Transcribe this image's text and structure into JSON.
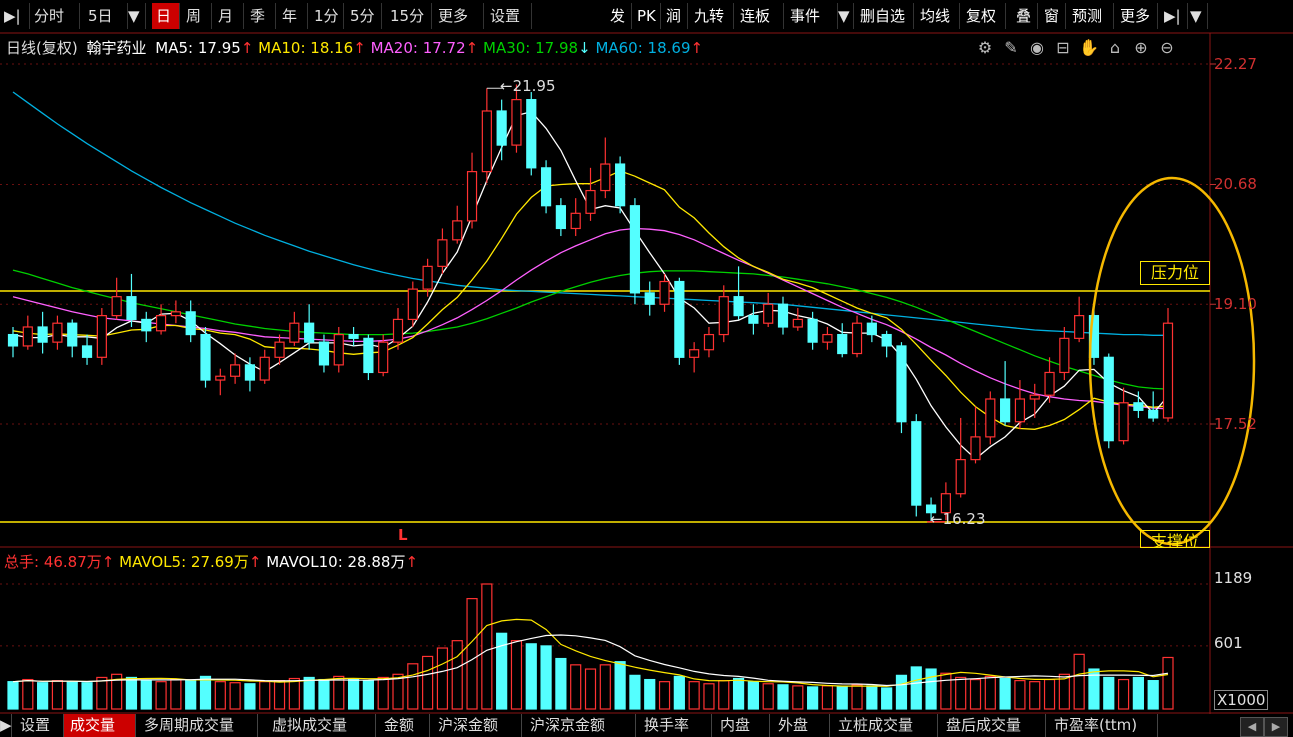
{
  "toolbar": {
    "left": [
      "分时",
      "5日",
      "日",
      "周",
      "月",
      "季",
      "年",
      "1分",
      "5分",
      "15分",
      "更多",
      "设置"
    ],
    "right": [
      "发",
      "PK",
      "涧",
      "九转",
      "连板",
      "事件",
      "删自选",
      "均线",
      "复权",
      "叠",
      "窗",
      "预测",
      "更多"
    ],
    "active": "日"
  },
  "info": {
    "period": "日线(复权)",
    "stock": "翰宇药业",
    "ma5": "MA5: 17.95",
    "ma10": "MA10: 18.16",
    "ma20": "MA20: 17.72",
    "ma30": "MA30: 17.98",
    "ma60": "MA60: 18.69",
    "arrow_up": "↑",
    "arrow_down": "↓"
  },
  "price_axis": [
    "22.27",
    "20.68",
    "19.10",
    "17.52"
  ],
  "annotations": {
    "high": "21.95",
    "low": "16.23",
    "marker": "L",
    "pressure": "压力位",
    "support": "支撑位"
  },
  "volume": {
    "total": "总手: 46.87万",
    "mavol5": "MAVOL5: 27.69万",
    "mavol10": "MAVOL10: 28.88万",
    "axis": [
      "1189",
      "601"
    ],
    "unit": "X1000"
  },
  "bottom_tabs": [
    "设置",
    "成交量",
    "多周期成交量",
    "虚拟成交量",
    "金额",
    "沪深金额",
    "沪深京金额",
    "换手率",
    "内盘",
    "外盘",
    "立桩成交量",
    "盘后成交量",
    "市盈率(ttm)"
  ],
  "bottom_active": "成交量",
  "colors": {
    "up": "#ff3232",
    "down": "#54ffff",
    "ma5": "#ffffff",
    "ma10": "#ffe800",
    "ma20": "#ff60ff",
    "ma30": "#00d000",
    "ma60": "#00b0e0",
    "accent": "#cc0000"
  },
  "icons": [
    "gear-icon",
    "pen-icon",
    "eye-icon",
    "box-icon",
    "hand-icon",
    "lock-icon",
    "zoom-in-icon",
    "zoom-out-icon"
  ],
  "candles": [
    [
      18.7,
      18.55,
      18.8,
      18.4
    ],
    [
      18.55,
      18.8,
      18.95,
      18.5
    ],
    [
      18.8,
      18.6,
      19.0,
      18.45
    ],
    [
      18.6,
      18.85,
      18.95,
      18.5
    ],
    [
      18.85,
      18.55,
      18.9,
      18.4
    ],
    [
      18.55,
      18.4,
      18.7,
      18.3
    ],
    [
      18.4,
      18.95,
      19.05,
      18.3
    ],
    [
      18.95,
      19.2,
      19.45,
      18.9
    ],
    [
      19.2,
      18.9,
      19.5,
      18.8
    ],
    [
      18.9,
      18.75,
      19.0,
      18.6
    ],
    [
      18.75,
      18.95,
      19.1,
      18.7
    ],
    [
      18.95,
      19.0,
      19.15,
      18.85
    ],
    [
      19.0,
      18.7,
      19.15,
      18.6
    ],
    [
      18.7,
      18.1,
      18.8,
      18.0
    ],
    [
      18.1,
      18.15,
      18.25,
      17.9
    ],
    [
      18.15,
      18.3,
      18.45,
      18.05
    ],
    [
      18.3,
      18.1,
      18.4,
      17.95
    ],
    [
      18.1,
      18.4,
      18.5,
      18.05
    ],
    [
      18.4,
      18.6,
      18.7,
      18.3
    ],
    [
      18.6,
      18.85,
      19.0,
      18.55
    ],
    [
      18.85,
      18.6,
      19.1,
      18.5
    ],
    [
      18.6,
      18.3,
      18.7,
      18.2
    ],
    [
      18.3,
      18.7,
      18.8,
      18.2
    ],
    [
      18.7,
      18.65,
      18.8,
      18.55
    ],
    [
      18.65,
      18.2,
      18.7,
      18.1
    ],
    [
      18.2,
      18.6,
      18.7,
      18.15
    ],
    [
      18.6,
      18.9,
      19.05,
      18.5
    ],
    [
      18.9,
      19.3,
      19.4,
      18.8
    ],
    [
      19.3,
      19.6,
      19.7,
      19.2
    ],
    [
      19.6,
      19.95,
      20.1,
      19.5
    ],
    [
      19.95,
      20.2,
      20.4,
      19.9
    ],
    [
      20.2,
      20.85,
      21.1,
      20.1
    ],
    [
      20.85,
      21.65,
      21.95,
      20.7
    ],
    [
      21.65,
      21.2,
      21.8,
      21.0
    ],
    [
      21.2,
      21.8,
      22.0,
      21.1
    ],
    [
      21.8,
      20.9,
      21.9,
      20.8
    ],
    [
      20.9,
      20.4,
      21.0,
      20.3
    ],
    [
      20.4,
      20.1,
      20.5,
      20.0
    ],
    [
      20.1,
      20.3,
      20.5,
      20.0
    ],
    [
      20.3,
      20.6,
      20.9,
      20.2
    ],
    [
      20.6,
      20.95,
      21.3,
      20.5
    ],
    [
      20.95,
      20.4,
      21.05,
      20.3
    ],
    [
      20.4,
      19.25,
      20.5,
      19.1
    ],
    [
      19.25,
      19.1,
      19.4,
      18.95
    ],
    [
      19.1,
      19.4,
      19.5,
      19.0
    ],
    [
      19.4,
      18.4,
      19.45,
      18.3
    ],
    [
      18.4,
      18.5,
      18.6,
      18.2
    ],
    [
      18.5,
      18.7,
      18.8,
      18.4
    ],
    [
      18.7,
      19.2,
      19.35,
      18.6
    ],
    [
      19.2,
      18.95,
      19.6,
      18.9
    ],
    [
      18.95,
      18.85,
      19.1,
      18.7
    ],
    [
      18.85,
      19.1,
      19.25,
      18.8
    ],
    [
      19.1,
      18.8,
      19.2,
      18.7
    ],
    [
      18.8,
      18.9,
      19.05,
      18.75
    ],
    [
      18.9,
      18.6,
      19.0,
      18.5
    ],
    [
      18.6,
      18.7,
      18.8,
      18.5
    ],
    [
      18.7,
      18.45,
      18.85,
      18.4
    ],
    [
      18.45,
      18.85,
      18.95,
      18.4
    ],
    [
      18.85,
      18.7,
      18.95,
      18.6
    ],
    [
      18.7,
      18.55,
      18.75,
      18.4
    ],
    [
      18.55,
      17.55,
      18.6,
      17.4
    ],
    [
      17.55,
      16.45,
      17.65,
      16.3
    ],
    [
      16.45,
      16.35,
      16.55,
      16.23
    ],
    [
      16.35,
      16.6,
      16.75,
      16.25
    ],
    [
      16.6,
      17.05,
      17.6,
      16.55
    ],
    [
      17.05,
      17.35,
      17.75,
      17.0
    ],
    [
      17.35,
      17.85,
      17.95,
      17.25
    ],
    [
      17.85,
      17.55,
      18.35,
      17.5
    ],
    [
      17.55,
      17.85,
      18.1,
      17.45
    ],
    [
      17.85,
      17.9,
      18.05,
      17.6
    ],
    [
      17.9,
      18.2,
      18.4,
      17.8
    ],
    [
      18.2,
      18.65,
      18.8,
      18.1
    ],
    [
      18.65,
      18.95,
      19.2,
      18.6
    ],
    [
      18.95,
      18.4,
      19.05,
      18.3
    ],
    [
      18.4,
      17.3,
      18.45,
      17.2
    ],
    [
      17.3,
      17.8,
      18.0,
      17.25
    ],
    [
      17.8,
      17.7,
      17.95,
      17.6
    ],
    [
      17.7,
      17.6,
      17.95,
      17.55
    ],
    [
      17.6,
      18.85,
      19.05,
      17.55
    ]
  ],
  "volumes": [
    260,
    280,
    250,
    270,
    260,
    250,
    300,
    330,
    300,
    270,
    260,
    280,
    270,
    310,
    260,
    250,
    240,
    260,
    270,
    290,
    300,
    280,
    310,
    280,
    270,
    300,
    330,
    430,
    500,
    580,
    650,
    1050,
    1189,
    720,
    650,
    620,
    600,
    480,
    420,
    380,
    420,
    450,
    320,
    280,
    260,
    310,
    260,
    240,
    270,
    290,
    260,
    240,
    230,
    220,
    210,
    220,
    210,
    230,
    220,
    200,
    320,
    400,
    380,
    340,
    300,
    280,
    310,
    290,
    270,
    260,
    280,
    330,
    520,
    380,
    300,
    280,
    300,
    270,
    490
  ],
  "ma_lines": {
    "ma5": [
      18.7,
      18.66,
      18.66,
      18.7,
      18.67,
      18.67,
      18.65,
      18.79,
      18.88,
      18.85,
      18.97,
      18.98,
      18.88,
      18.72,
      18.58,
      18.43,
      18.31,
      18.21,
      18.33,
      18.46,
      18.59,
      18.59,
      18.59,
      18.55,
      18.57,
      18.53,
      18.65,
      18.81,
      19.13,
      19.51,
      19.79,
      20.26,
      20.73,
      21.17,
      21.59,
      21.64,
      21.42,
      21.13,
      20.73,
      20.35,
      20.4,
      20.37,
      20.07,
      19.78,
      19.5,
      19.18,
      19.05,
      18.85,
      18.86,
      18.89,
      18.98,
      19.02,
      19.01,
      18.95,
      18.91,
      18.84,
      18.73,
      18.72,
      18.72,
      18.63,
      18.41,
      18.11,
      17.76,
      17.48,
      17.24,
      17.06,
      17.22,
      17.35,
      17.54,
      17.65,
      17.89,
      18.02,
      18.23,
      18.24,
      18.06,
      17.96,
      17.88,
      17.66,
      17.89
    ],
    "ma10": [
      18.75,
      18.72,
      18.7,
      18.71,
      18.7,
      18.69,
      18.68,
      18.72,
      18.76,
      18.77,
      18.82,
      18.82,
      18.78,
      18.76,
      18.72,
      18.7,
      18.64,
      18.54,
      18.52,
      18.52,
      18.51,
      18.49,
      18.46,
      18.44,
      18.46,
      18.47,
      18.56,
      18.66,
      18.84,
      19.03,
      19.19,
      19.42,
      19.67,
      19.97,
      20.29,
      20.51,
      20.66,
      20.68,
      20.69,
      20.69,
      20.77,
      20.86,
      20.79,
      20.7,
      20.61,
      20.38,
      20.24,
      20.04,
      19.86,
      19.71,
      19.6,
      19.52,
      19.43,
      19.38,
      19.32,
      19.23,
      19.14,
      19.05,
      18.98,
      18.92,
      18.77,
      18.57,
      18.36,
      18.16,
      17.94,
      17.75,
      17.61,
      17.5,
      17.46,
      17.45,
      17.5,
      17.58,
      17.71,
      17.86,
      17.81,
      17.78,
      17.77,
      17.74,
      17.76
    ],
    "ma20": [
      19.2,
      19.15,
      19.1,
      19.05,
      19.0,
      18.96,
      18.92,
      18.9,
      18.88,
      18.86,
      18.84,
      18.82,
      18.8,
      18.78,
      18.75,
      18.73,
      18.7,
      18.67,
      18.66,
      18.65,
      18.64,
      18.63,
      18.62,
      18.61,
      18.61,
      18.62,
      18.64,
      18.68,
      18.75,
      18.83,
      18.92,
      19.03,
      19.15,
      19.28,
      19.42,
      19.55,
      19.67,
      19.78,
      19.87,
      19.95,
      20.03,
      20.08,
      20.1,
      20.09,
      20.07,
      20.02,
      19.95,
      19.86,
      19.77,
      19.68,
      19.6,
      19.51,
      19.42,
      19.33,
      19.24,
      19.15,
      19.06,
      18.98,
      18.9,
      18.83,
      18.74,
      18.64,
      18.53,
      18.43,
      18.32,
      18.22,
      18.13,
      18.05,
      17.98,
      17.92,
      17.88,
      17.85,
      17.83,
      17.82,
      17.79,
      17.77,
      17.75,
      17.73,
      17.72
    ],
    "ma30": [
      19.55,
      19.5,
      19.44,
      19.38,
      19.32,
      19.27,
      19.22,
      19.17,
      19.12,
      19.08,
      19.04,
      19.0,
      18.96,
      18.92,
      18.88,
      18.84,
      18.81,
      18.78,
      18.76,
      18.74,
      18.73,
      18.72,
      18.71,
      18.7,
      18.7,
      18.7,
      18.71,
      18.72,
      18.74,
      18.77,
      18.8,
      18.85,
      18.91,
      18.98,
      19.05,
      19.13,
      19.2,
      19.27,
      19.33,
      19.39,
      19.44,
      19.48,
      19.51,
      19.53,
      19.54,
      19.54,
      19.54,
      19.53,
      19.52,
      19.51,
      19.5,
      19.48,
      19.46,
      19.43,
      19.4,
      19.37,
      19.33,
      19.29,
      19.24,
      19.19,
      19.13,
      19.06,
      18.98,
      18.9,
      18.82,
      18.74,
      18.66,
      18.58,
      18.5,
      18.42,
      18.35,
      18.28,
      18.22,
      18.16,
      18.1,
      18.05,
      18.01,
      17.99,
      17.98
    ],
    "ma60": [
      21.9,
      21.76,
      21.62,
      21.48,
      21.35,
      21.22,
      21.1,
      20.98,
      20.86,
      20.75,
      20.64,
      20.54,
      20.44,
      20.35,
      20.26,
      20.17,
      20.09,
      20.01,
      19.94,
      19.87,
      19.8,
      19.74,
      19.68,
      19.62,
      19.57,
      19.52,
      19.48,
      19.44,
      19.41,
      19.38,
      19.35,
      19.33,
      19.31,
      19.29,
      19.28,
      19.27,
      19.26,
      19.25,
      19.24,
      19.23,
      19.22,
      19.21,
      19.2,
      19.19,
      19.18,
      19.17,
      19.16,
      19.15,
      19.14,
      19.13,
      19.12,
      19.11,
      19.1,
      19.08,
      19.06,
      19.04,
      19.02,
      19.0,
      18.98,
      18.96,
      18.94,
      18.92,
      18.9,
      18.88,
      18.86,
      18.84,
      18.82,
      18.8,
      18.78,
      18.76,
      18.75,
      18.74,
      18.73,
      18.72,
      18.71,
      18.7,
      18.7,
      18.69,
      18.69
    ]
  }
}
